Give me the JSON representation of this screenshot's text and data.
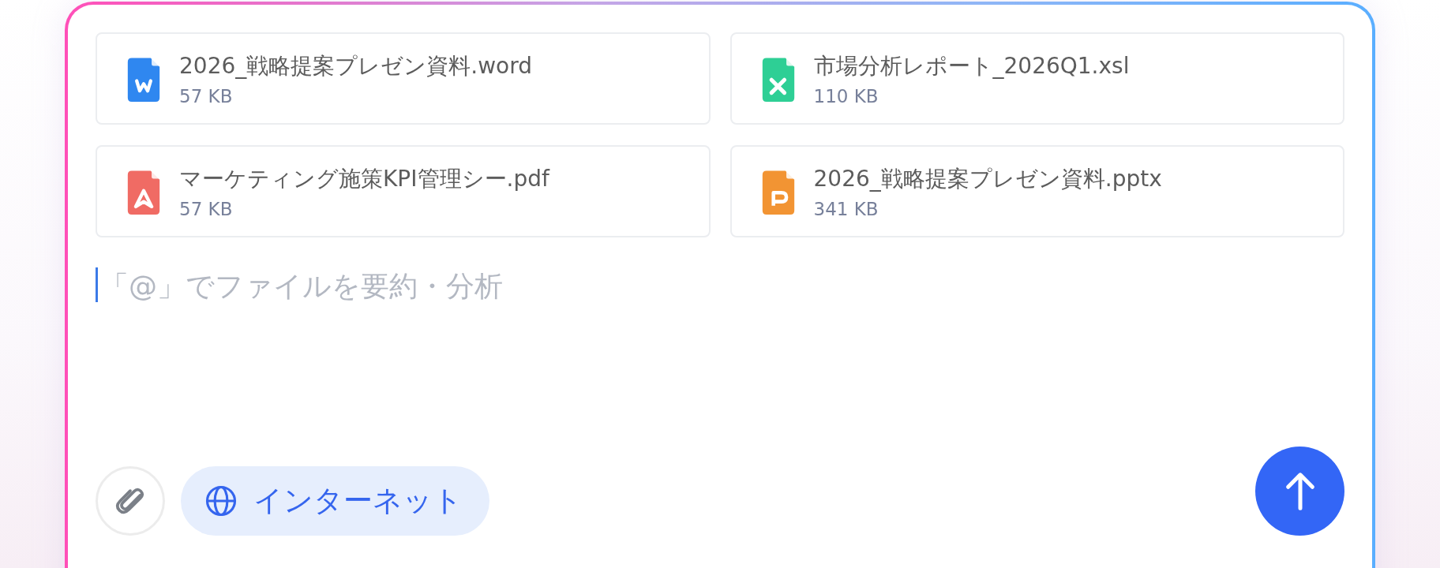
{
  "attachments": [
    {
      "kind": "word",
      "name": "2026_戦略提案プレゼン資料.word",
      "size": "57 KB"
    },
    {
      "kind": "excel",
      "name": "市場分析レポート_2026Q1.xsl",
      "size": "110 KB"
    },
    {
      "kind": "pdf",
      "name": "マーケティング施策KPI管理シー.pdf",
      "size": "57 KB"
    },
    {
      "kind": "ppt",
      "name": "2026_戦略提案プレゼン資料.pptx",
      "size": "341 KB"
    }
  ],
  "composer": {
    "placeholder": "「@」でファイルを要約・分析"
  },
  "internet_toggle": {
    "label": "インターネット",
    "selected": true
  }
}
